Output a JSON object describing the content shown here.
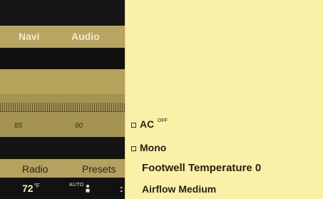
{
  "nav_tabs": [
    "Navi",
    "Audio"
  ],
  "tuner": {
    "frequency_labels": [
      "85",
      "90"
    ]
  },
  "bottom_tabs": [
    "Radio",
    "Presets"
  ],
  "climate": {
    "temperature": "72",
    "temperature_unit": "°F",
    "mode": "AUTO",
    "fan_icon": "fan-icon"
  },
  "menu": {
    "ac_label": "AC",
    "ac_state": "OFF",
    "mono_label": "Mono",
    "footwell_label": "Footwell Temperature",
    "footwell_value": "0",
    "airflow_label": "Airflow Medium"
  },
  "colors": {
    "panel_bg": "#fbf0a8",
    "gold": "#b5a35c",
    "dark": "#121212"
  }
}
